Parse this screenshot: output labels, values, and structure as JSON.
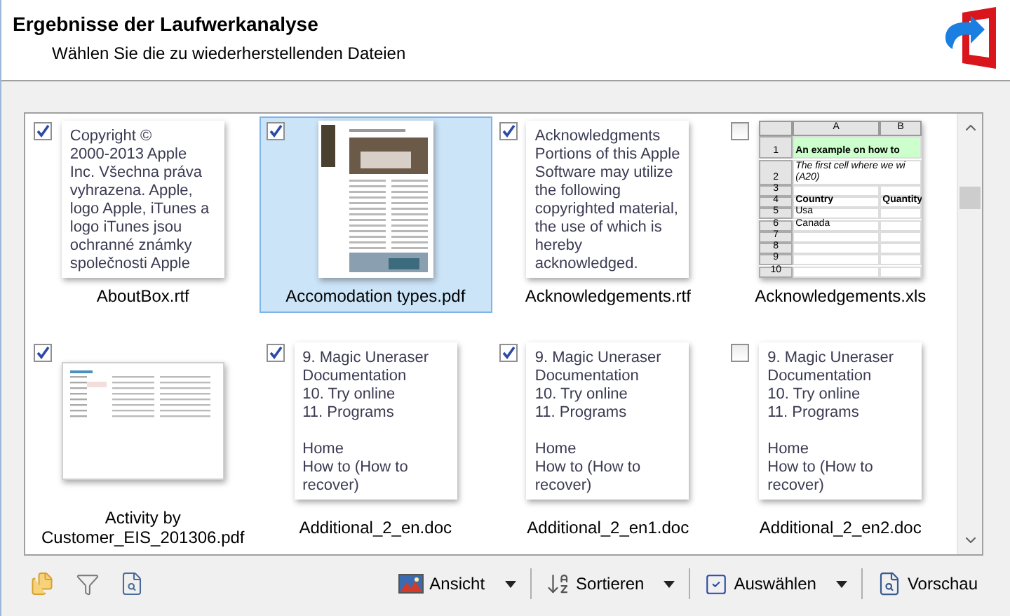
{
  "header": {
    "title": "Ergebnisse der Laufwerkanalyse",
    "subtitle": "Wählen Sie die zu wiederherstellenden Dateien"
  },
  "files": [
    {
      "name": "AboutBox.rtf",
      "checked": true,
      "selected": false,
      "kind": "text",
      "paragraphs": [
        [
          "Copyright ©",
          "2000-2013 Apple",
          "Inc. Všechna práva",
          "vyhrazena. Apple,",
          "logo Apple, iTunes a",
          "logo iTunes jsou",
          "ochranné známky",
          "společnosti Apple"
        ]
      ]
    },
    {
      "name": "Accomodation types.pdf",
      "checked": true,
      "selected": true,
      "kind": "brochure"
    },
    {
      "name": "Acknowledgements.rtf",
      "checked": true,
      "selected": false,
      "kind": "text",
      "paragraphs": [
        [
          "Acknowledgments",
          "Portions of this Apple",
          "Software may utilize",
          "the following",
          "copyrighted material,",
          "the use of which is",
          "hereby",
          "acknowledged."
        ]
      ]
    },
    {
      "name": "Acknowledgements.xls",
      "checked": false,
      "selected": false,
      "kind": "sheet",
      "sheet": {
        "columns": [
          "A",
          "B"
        ],
        "rows": [
          {
            "number": "1",
            "kind": "title",
            "cells": [
              "An example on how to"
            ]
          },
          {
            "number": "2",
            "kind": "note",
            "cells": [
              {
                "lines": [
                  "The first cell where we wi",
                  "(A20)"
                ]
              }
            ]
          },
          {
            "number": "3",
            "kind": "plain",
            "cells": []
          },
          {
            "number": "4",
            "kind": "head",
            "cells": [
              "Country",
              "Quantity"
            ]
          },
          {
            "number": "5",
            "kind": "plain",
            "cells": [
              "Usa"
            ]
          },
          {
            "number": "6",
            "kind": "plain",
            "cells": [
              "Canada"
            ]
          },
          {
            "number": "7",
            "kind": "plain",
            "cells": []
          },
          {
            "number": "8",
            "kind": "plain",
            "cells": []
          },
          {
            "number": "9",
            "kind": "plain",
            "cells": []
          },
          {
            "number": "10",
            "kind": "plain",
            "cells": []
          }
        ]
      }
    },
    {
      "name": "Activity by Customer_EIS_201306.pdf",
      "checked": true,
      "selected": false,
      "kind": "report"
    },
    {
      "name": "Additional_2_en.doc",
      "checked": true,
      "selected": false,
      "kind": "text",
      "paragraphs": [
        [
          "9. Magic Uneraser",
          "Documentation",
          "10. Try online",
          "11. Programs"
        ],
        [
          "Home",
          "How to (How to",
          "recover)"
        ]
      ]
    },
    {
      "name": "Additional_2_en1.doc",
      "checked": true,
      "selected": false,
      "kind": "text",
      "paragraphs": [
        [
          "9. Magic Uneraser",
          "Documentation",
          "10. Try online",
          "11. Programs"
        ],
        [
          "Home",
          "How to (How to",
          "recover)"
        ]
      ]
    },
    {
      "name": "Additional_2_en2.doc",
      "checked": false,
      "selected": false,
      "kind": "text",
      "paragraphs": [
        [
          "9. Magic Uneraser",
          "Documentation",
          "10. Try online",
          "11. Programs"
        ],
        [
          "Home",
          "How to (How to",
          "recover)"
        ]
      ]
    }
  ],
  "toolbar": {
    "buttons": [
      {
        "label": "Ansicht",
        "kind": "view",
        "dropdown": true
      },
      {
        "label": "Sortieren",
        "kind": "sort",
        "dropdown": true
      },
      {
        "label": "Auswählen",
        "kind": "select",
        "dropdown": true
      },
      {
        "label": "Vorschau",
        "kind": "preview",
        "dropdown": false
      }
    ]
  }
}
